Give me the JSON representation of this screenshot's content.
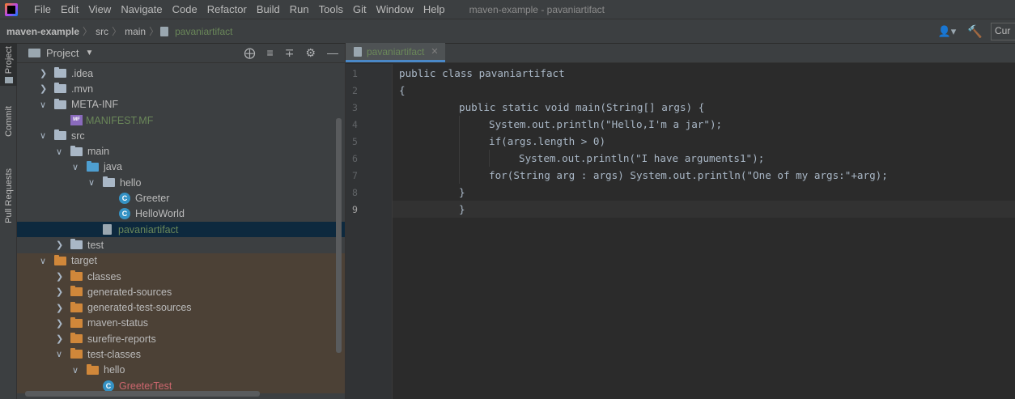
{
  "menubar": {
    "items": [
      {
        "label": "File",
        "name": "menu-file"
      },
      {
        "label": "Edit",
        "name": "menu-edit"
      },
      {
        "label": "View",
        "name": "menu-view"
      },
      {
        "label": "Navigate",
        "name": "menu-navigate"
      },
      {
        "label": "Code",
        "name": "menu-code"
      },
      {
        "label": "Refactor",
        "name": "menu-refactor"
      },
      {
        "label": "Build",
        "name": "menu-build"
      },
      {
        "label": "Run",
        "name": "menu-run"
      },
      {
        "label": "Tools",
        "name": "menu-tools"
      },
      {
        "label": "Git",
        "name": "menu-git"
      },
      {
        "label": "Window",
        "name": "menu-window"
      },
      {
        "label": "Help",
        "name": "menu-help"
      }
    ],
    "window_title": "maven-example - pavaniartifact"
  },
  "navbar": {
    "crumbs": [
      "maven-example",
      "src",
      "main",
      "pavaniartifact"
    ],
    "run_config": "Cur"
  },
  "toolstrip": {
    "project": "Project",
    "commit": "Commit",
    "pull_requests": "Pull Requests"
  },
  "project_panel": {
    "title": "Project",
    "tree": [
      {
        "label": ".idea",
        "indent": 0,
        "arrow": "right",
        "icon": "folder",
        "style": ""
      },
      {
        "label": ".mvn",
        "indent": 0,
        "arrow": "right",
        "icon": "folder",
        "style": ""
      },
      {
        "label": "META-INF",
        "indent": 0,
        "arrow": "down",
        "icon": "folder",
        "style": ""
      },
      {
        "label": "MANIFEST.MF",
        "indent": 1,
        "arrow": "",
        "icon": "manifest",
        "style": "green"
      },
      {
        "label": "src",
        "indent": 0,
        "arrow": "down",
        "icon": "folder",
        "style": ""
      },
      {
        "label": "main",
        "indent": 1,
        "arrow": "down",
        "icon": "folder",
        "style": ""
      },
      {
        "label": "java",
        "indent": 2,
        "arrow": "down",
        "icon": "folder-blue",
        "style": ""
      },
      {
        "label": "hello",
        "indent": 3,
        "arrow": "down",
        "icon": "package",
        "style": ""
      },
      {
        "label": "Greeter",
        "indent": 4,
        "arrow": "",
        "icon": "class",
        "style": ""
      },
      {
        "label": "HelloWorld",
        "indent": 4,
        "arrow": "",
        "icon": "class-main",
        "style": ""
      },
      {
        "label": "pavaniartifact",
        "indent": 3,
        "arrow": "",
        "icon": "file",
        "style": "green",
        "selected": true
      },
      {
        "label": "test",
        "indent": 1,
        "arrow": "right",
        "icon": "folder",
        "style": ""
      },
      {
        "label": "target",
        "indent": 0,
        "arrow": "down",
        "icon": "folder-orange",
        "style": "",
        "excluded": true
      },
      {
        "label": "classes",
        "indent": 1,
        "arrow": "right",
        "icon": "folder-orange",
        "style": "",
        "excluded": true
      },
      {
        "label": "generated-sources",
        "indent": 1,
        "arrow": "right",
        "icon": "folder-orange",
        "style": "",
        "excluded": true
      },
      {
        "label": "generated-test-sources",
        "indent": 1,
        "arrow": "right",
        "icon": "folder-orange",
        "style": "",
        "excluded": true
      },
      {
        "label": "maven-status",
        "indent": 1,
        "arrow": "right",
        "icon": "folder-orange",
        "style": "",
        "excluded": true
      },
      {
        "label": "surefire-reports",
        "indent": 1,
        "arrow": "right",
        "icon": "folder-orange",
        "style": "",
        "excluded": true
      },
      {
        "label": "test-classes",
        "indent": 1,
        "arrow": "down",
        "icon": "folder-orange",
        "style": "",
        "excluded": true
      },
      {
        "label": "hello",
        "indent": 2,
        "arrow": "down",
        "icon": "folder-orange",
        "style": "",
        "excluded": true
      },
      {
        "label": "GreeterTest",
        "indent": 3,
        "arrow": "",
        "icon": "class-test",
        "style": "red",
        "excluded": true
      }
    ]
  },
  "editor": {
    "tab_label": "pavaniartifact",
    "lines": [
      {
        "num": "1",
        "text": "public class pavaniartifact",
        "indent": 0
      },
      {
        "num": "2",
        "text": "{",
        "indent": 0
      },
      {
        "num": "3",
        "text": "public static void main(String[] args) {",
        "indent": 2
      },
      {
        "num": "4",
        "text": "System.out.println(\"Hello,I'm a jar\");",
        "indent": 3
      },
      {
        "num": "5",
        "text": "if(args.length > 0)",
        "indent": 3
      },
      {
        "num": "6",
        "text": "System.out.println(\"I have arguments1\");",
        "indent": 4
      },
      {
        "num": "7",
        "text": "for(String arg : args) System.out.println(\"One of my args:\"+arg);",
        "indent": 3
      },
      {
        "num": "8",
        "text": "}",
        "indent": 2
      },
      {
        "num": "9",
        "text": "}",
        "indent": 2,
        "current": true
      }
    ]
  }
}
